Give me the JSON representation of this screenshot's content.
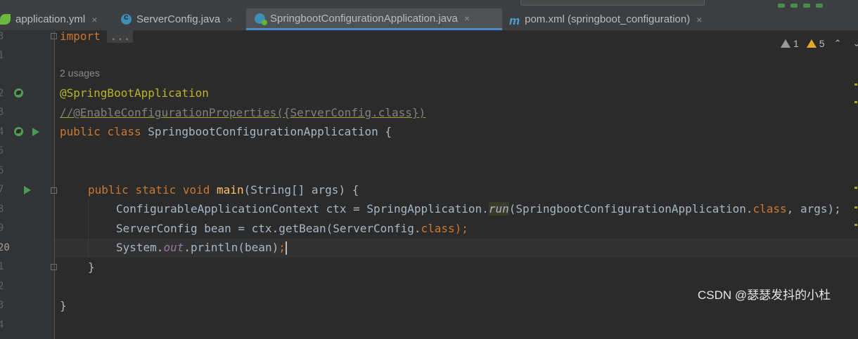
{
  "tabs": [
    {
      "label": "application.yml",
      "icon": "yaml-leaf-icon",
      "active": false
    },
    {
      "label": "ServerConfig.java",
      "icon": "java-class-icon",
      "active": false
    },
    {
      "label": "SpringbootConfigurationApplication.java",
      "icon": "spring-class-icon",
      "active": true
    },
    {
      "label": "pom.xml (springboot_configuration)",
      "icon": "maven-icon",
      "active": false
    }
  ],
  "tab_close_symbol": "×",
  "inspection": {
    "weak_warnings": "1",
    "warnings": "5"
  },
  "line_numbers": [
    "3",
    "1",
    "",
    "2",
    "3",
    "4",
    "5",
    "6",
    "7",
    "8",
    "9",
    "20",
    "1",
    "2",
    "3",
    "4"
  ],
  "code": {
    "import_kw": "import",
    "import_fold": "...",
    "usages_hint": "2 usages",
    "annotation": "@SpringBootApplication",
    "commented": "//@EnableConfigurationProperties({ServerConfig.class})",
    "class_line": {
      "kw1": "public",
      "kw2": "class",
      "name": "SpringbootConfigurationApplication",
      "brace": "{"
    },
    "main_line": {
      "kw1": "public",
      "kw2": "static",
      "kw3": "void",
      "method": "main",
      "params": "(String[] args) {"
    },
    "line_ctx": {
      "pre": "ConfigurableApplicationContext ctx = SpringApplication.",
      "run": "run",
      "mid": "(SpringbootConfigurationApplication.",
      "kw": "class",
      "post": ", args);"
    },
    "line_bean": {
      "pre": "ServerConfig bean = ctx.getBean(ServerConfig.",
      "kw": "class",
      "post": ");"
    },
    "line_print": {
      "pre": "System.",
      "out": "out",
      "mid": ".println(bean)",
      "semi": ";"
    },
    "close_method": "}",
    "close_class": "}"
  },
  "watermark": "CSDN @瑟瑟发抖的小杜",
  "colors": {
    "background": "#2b2b2b",
    "gutter": "#313335",
    "keyword": "#cc7832",
    "annotation": "#bbb529",
    "method": "#ffc66d",
    "static_field": "#9876aa",
    "text": "#a9b7c6",
    "comment": "#808080",
    "active_tab_underline": "#4a88c7"
  }
}
